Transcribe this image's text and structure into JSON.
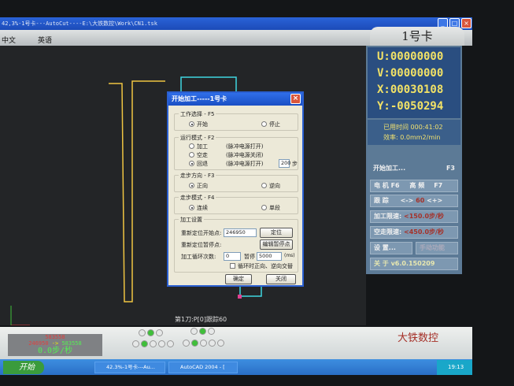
{
  "window": {
    "title": "42,3%-1号卡---AutoCut----E:\\大铁数控\\Work\\CN1.tsk"
  },
  "menu": [
    "中文",
    "英语"
  ],
  "card": {
    "title": "1号卡"
  },
  "coords": {
    "u": "U:00000000",
    "v": "V:00000000",
    "x": "X:00030108",
    "y": "Y:-0050294"
  },
  "time": {
    "elapsed_label": "已用时间",
    "elapsed": "000:41:02",
    "eff_label": "效率:",
    "eff": "0.0mm2/min"
  },
  "panel": {
    "start": "开始加工...",
    "start_key": "F3",
    "motor": "电 机",
    "motor_key": "F6",
    "hf": "高 频",
    "hf_key": "F7",
    "track": "跟 踪",
    "minus": "<->",
    "track_val": "60",
    "plus": "<+>",
    "cut_speed_label": "加工限速:",
    "cut_speed": "<150.0步/秒",
    "idle_speed_label": "空走限速:",
    "idle_speed": "<450.0步/秒",
    "settings": "设 置...",
    "manual": "手动功能",
    "about": "关 于 v6.0.150209"
  },
  "canvas": {
    "status": "第1刀:P[0]跟踪60"
  },
  "statusbox": {
    "line1": "583558",
    "line2": "246950",
    "arrow": "->",
    "line3": "583558",
    "speed": "0.0步/秒"
  },
  "brand": "大铁数控",
  "leds": {
    "row1a": [
      false,
      true,
      false
    ],
    "row1b": [
      false,
      true,
      false
    ],
    "row2a": [
      false,
      true,
      false,
      false,
      false
    ],
    "row2b": [
      false,
      true,
      false,
      false,
      false
    ]
  },
  "taskbar": {
    "start": "开始",
    "tasks": [
      "42.3%-1号卡---Au...",
      "AutoCAD 2004 - ["
    ],
    "clock": "19:13"
  },
  "dialog": {
    "title": "开始加工-----1号卡",
    "work": {
      "label": "工作选择 - F5",
      "opts": [
        "开始",
        "停止"
      ],
      "selected": 0
    },
    "mode": {
      "label": "运行模式 - F2",
      "opts": [
        "加工",
        "空走",
        "回退"
      ],
      "notes": [
        "(脉冲电源打开)",
        "(脉冲电源关闭)",
        "(脉冲电源打开)"
      ],
      "selected": 2,
      "steps": "200",
      "steps_unit": "步"
    },
    "dir": {
      "label": "走步方向 - F3",
      "opts": [
        "正向",
        "逆向"
      ],
      "selected": 0
    },
    "step": {
      "label": "走步模式 - F4",
      "opts": [
        "连续",
        "单段"
      ],
      "selected": 0
    },
    "setup": {
      "label": "加工设置",
      "reloc_start": "重新定位开始点:",
      "reloc_val": "246950",
      "locate": "定位",
      "reloc_pause": "重新定位暂停点:",
      "edit_pause": "编辑暂停点",
      "loops": "加工循环次数:",
      "loops_val": "0",
      "pause": "暂停",
      "pause_val": "5000",
      "pause_unit": "(ms)",
      "alt": "循环时正向、逆向交替",
      "alt_checked": false
    },
    "ok": "确定",
    "close": "关闭"
  }
}
